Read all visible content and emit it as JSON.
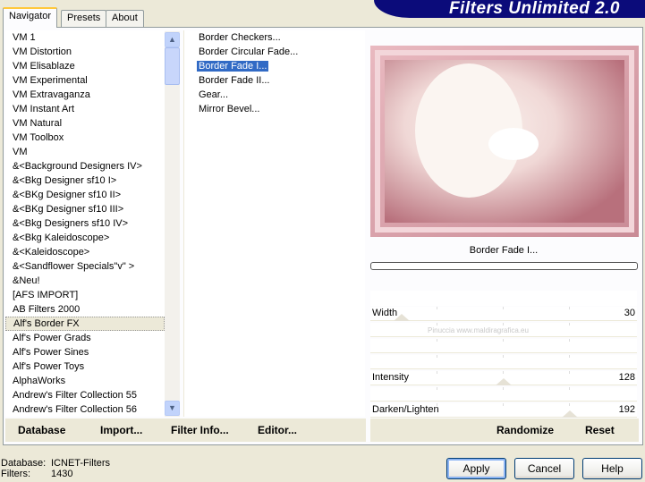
{
  "app": {
    "title": "Filters Unlimited 2.0"
  },
  "tabs": [
    {
      "label": "Navigator"
    },
    {
      "label": "Presets"
    },
    {
      "label": "About"
    }
  ],
  "categories": [
    "VM 1",
    "VM Distortion",
    "VM Elisablaze",
    "VM Experimental",
    "VM Extravaganza",
    "VM Instant Art",
    "VM Natural",
    "VM Toolbox",
    "VM",
    "&<Background Designers IV>",
    "&<Bkg Designer sf10 I>",
    "&<BKg Designer sf10 II>",
    "&<BKg Designer sf10 III>",
    "&<Bkg Designers sf10 IV>",
    "&<Bkg Kaleidoscope>",
    "&<Kaleidoscope>",
    "&<Sandflower Specials\"v\" >",
    "&Neu!",
    "[AFS IMPORT]",
    "AB Filters 2000",
    "Alf's Border FX",
    "Alf's Power Grads",
    "Alf's Power Sines",
    "Alf's Power Toys",
    "AlphaWorks",
    "Andrew's Filter Collection 55",
    "Andrew's Filter Collection 56"
  ],
  "selected_category": "Alf's Border FX",
  "filters": [
    "Border Checkers...",
    "Border Circular Fade...",
    "Border Fade I...",
    "Border Fade II...",
    "Gear...",
    "Mirror Bevel..."
  ],
  "selected_filter": "Border Fade I...",
  "preview": {
    "filter_name": "Border Fade I...",
    "progress": 0,
    "watermark": "Pinuccia www.maldiragrafica.eu"
  },
  "sliders": [
    {
      "label": "Width",
      "value": 30,
      "max": 255
    },
    {
      "label": "Intensity",
      "value": 128,
      "max": 255
    },
    {
      "label": "Darken/Lighten",
      "value": 192,
      "max": 255
    }
  ],
  "bottom_left": {
    "database": "Database",
    "import": "Import...",
    "filter_info": "Filter Info...",
    "editor": "Editor..."
  },
  "bottom_right": {
    "randomize": "Randomize",
    "reset": "Reset"
  },
  "status": {
    "database_label": "Database:",
    "database_value": "ICNET-Filters",
    "filters_label": "Filters:",
    "filters_value": "1430"
  },
  "buttons": {
    "apply": "Apply",
    "cancel": "Cancel",
    "help": "Help"
  }
}
